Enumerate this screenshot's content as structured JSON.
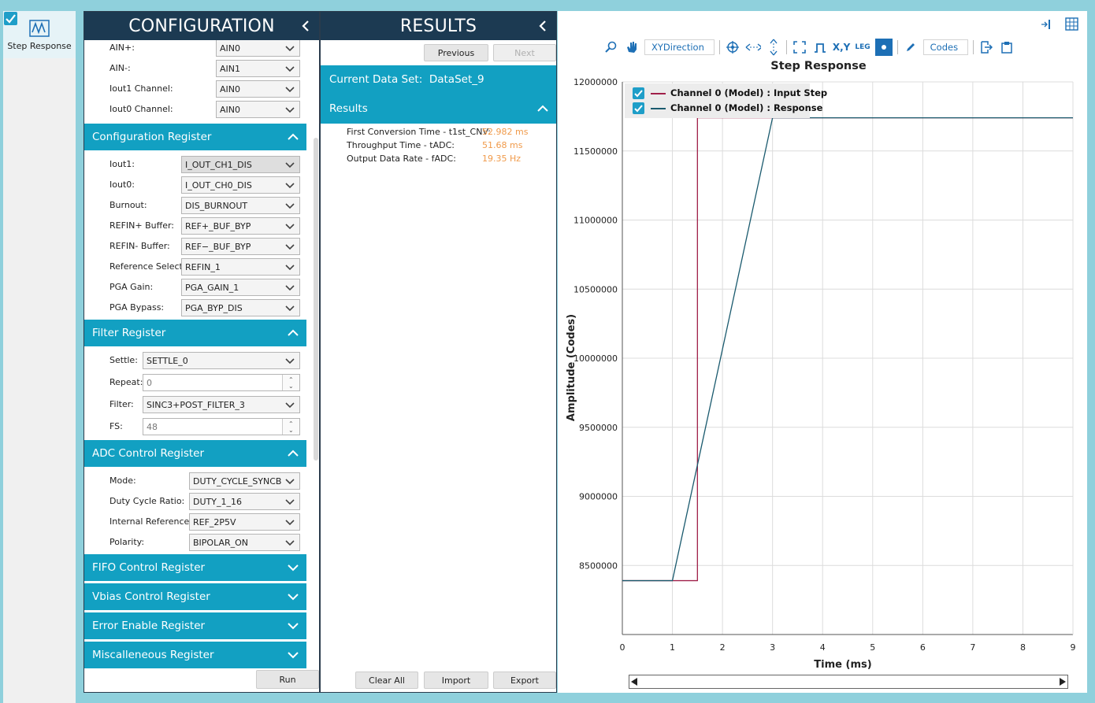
{
  "sidebar": {
    "tile_label": "Step Response",
    "tile_checked": true
  },
  "config": {
    "title": "CONFIGURATION",
    "top_rows": [
      {
        "label": "AIN+:",
        "value": "AIN0"
      },
      {
        "label": "AIN-:",
        "value": "AIN1"
      },
      {
        "label": "Iout1 Channel:",
        "value": "AIN0"
      },
      {
        "label": "Iout0 Channel:",
        "value": "AIN0"
      }
    ],
    "sections": [
      {
        "title": "Configuration Register",
        "expanded": true,
        "rows": [
          {
            "label": "Iout1:",
            "value": "I_OUT_CH1_DIS"
          },
          {
            "label": "Iout0:",
            "value": "I_OUT_CH0_DIS"
          },
          {
            "label": "Burnout:",
            "value": "DIS_BURNOUT"
          },
          {
            "label": "REFIN+ Buffer:",
            "value": "REF+_BUF_BYP"
          },
          {
            "label": "REFIN- Buffer:",
            "value": "REF−_BUF_BYP"
          },
          {
            "label": "Reference Select:",
            "value": "REFIN_1"
          },
          {
            "label": "PGA Gain:",
            "value": "PGA_GAIN_1"
          },
          {
            "label": "PGA Bypass:",
            "value": "PGA_BYP_DIS"
          }
        ]
      },
      {
        "title": "Filter Register",
        "expanded": true,
        "rows": [
          {
            "label": "Settle:",
            "value": "SETTLE_0",
            "kind": "dropdown"
          },
          {
            "label": "Repeat:",
            "value": "0",
            "kind": "spinner"
          },
          {
            "label": "Filter:",
            "value": "SINC3+POST_FILTER_3",
            "kind": "dropdown"
          },
          {
            "label": "FS:",
            "value": "48",
            "kind": "spinner"
          }
        ]
      },
      {
        "title": "ADC Control Register",
        "expanded": true,
        "rows": [
          {
            "label": "Mode:",
            "value": "DUTY_CYCLE_SYNCB"
          },
          {
            "label": "Duty Cycle Ratio:",
            "value": "DUTY_1_16"
          },
          {
            "label": "Internal Reference:",
            "value": "REF_2P5V"
          },
          {
            "label": "Polarity:",
            "value": "BIPOLAR_ON"
          }
        ]
      },
      {
        "title": "FIFO Control Register",
        "expanded": false,
        "rows": []
      },
      {
        "title": "Vbias Control Register",
        "expanded": false,
        "rows": []
      },
      {
        "title": "Error Enable Register",
        "expanded": false,
        "rows": []
      },
      {
        "title": "Miscalleneous Register",
        "expanded": false,
        "rows": []
      }
    ],
    "run_label": "Run"
  },
  "results": {
    "title": "RESULTS",
    "previous_label": "Previous",
    "next_label": "Next",
    "current_dataset_label": "Current Data Set:",
    "current_dataset_value": "DataSet_9",
    "results_label": "Results",
    "items": [
      {
        "key": "First Conversion Time - t1st_CNV:",
        "value": "52.982 ms"
      },
      {
        "key": "Throughput Time - tADC:",
        "value": "51.68 ms"
      },
      {
        "key": "Output Data Rate - fADC:",
        "value": "19.35 Hz"
      }
    ],
    "clear_label": "Clear All",
    "import_label": "Import",
    "export_label": "Export"
  },
  "toolbar": {
    "xydirection_label": "XYDirection",
    "xy_label": "X,Y",
    "leg_label": "LEG",
    "codes_label": "Codes"
  },
  "colors": {
    "header_dark": "#1c3a52",
    "section_blue": "#12a0c2",
    "accent_orange": "#f09a4a",
    "input_step_line": "#a0204a",
    "response_line": "#1a5a6e"
  },
  "chart_data": {
    "type": "line",
    "title": "Step Response",
    "xlabel": "Time (ms)",
    "ylabel": "Amplitude (Codes)",
    "xlim": [
      0,
      9
    ],
    "ylim": [
      8000000,
      12000000
    ],
    "xticks": [
      0,
      1,
      2,
      3,
      4,
      5,
      6,
      7,
      8,
      9
    ],
    "yticks": [
      8500000,
      9000000,
      9500000,
      10000000,
      10500000,
      11000000,
      11500000,
      12000000
    ],
    "grid": true,
    "legend_position": "top-left",
    "series": [
      {
        "name": "Channel 0 (Model) : Input Step",
        "color": "#a0204a",
        "x": [
          0,
          1.5,
          1.5,
          9
        ],
        "y": [
          8390000,
          8390000,
          11740000,
          11740000
        ]
      },
      {
        "name": "Channel 0 (Model) : Response",
        "color": "#1a5a6e",
        "x": [
          0,
          1,
          3,
          9
        ],
        "y": [
          8390000,
          8390000,
          11740000,
          11740000
        ]
      }
    ]
  }
}
